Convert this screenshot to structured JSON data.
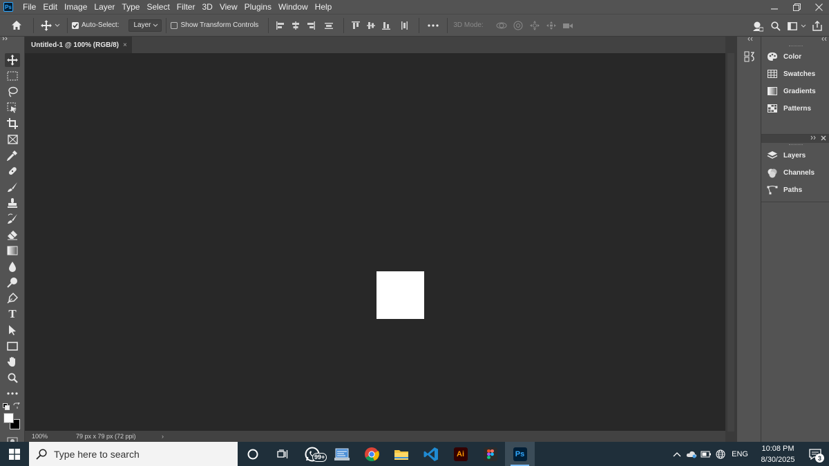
{
  "app": {
    "logo_text": "Ps",
    "menu": [
      "File",
      "Edit",
      "Image",
      "Layer",
      "Type",
      "Select",
      "Filter",
      "3D",
      "View",
      "Plugins",
      "Window",
      "Help"
    ]
  },
  "options_bar": {
    "auto_select_label": "Auto-Select:",
    "auto_select_checked": true,
    "target_select_value": "Layer",
    "show_transform_label": "Show Transform Controls",
    "show_transform_checked": false,
    "mode_3d_label": "3D Mode:"
  },
  "document": {
    "tab_title": "Untitled-1 @ 100% (RGB/8)",
    "close_glyph": "×",
    "zoom": "100%",
    "doc_info": "79 px x 79 px (72 ppi)",
    "status_arrow": "›"
  },
  "tools": [
    {
      "name": "move-tool-icon",
      "active": true
    },
    {
      "name": "rectangular-marquee-tool-icon"
    },
    {
      "name": "lasso-tool-icon"
    },
    {
      "name": "object-selection-tool-icon"
    },
    {
      "name": "crop-tool-icon"
    },
    {
      "name": "frame-tool-icon"
    },
    {
      "name": "eyedropper-tool-icon"
    },
    {
      "name": "healing-brush-tool-icon"
    },
    {
      "name": "brush-tool-icon"
    },
    {
      "name": "clone-stamp-tool-icon"
    },
    {
      "name": "history-brush-tool-icon"
    },
    {
      "name": "eraser-tool-icon"
    },
    {
      "name": "gradient-tool-icon"
    },
    {
      "name": "blur-tool-icon"
    },
    {
      "name": "dodge-tool-icon"
    },
    {
      "name": "pen-tool-icon"
    },
    {
      "name": "type-tool-icon"
    },
    {
      "name": "path-selection-tool-icon"
    },
    {
      "name": "rectangle-tool-icon"
    },
    {
      "name": "hand-tool-icon"
    },
    {
      "name": "zoom-tool-icon"
    },
    {
      "name": "edit-toolbar-icon"
    }
  ],
  "type_tool_glyph": "T",
  "panels": {
    "group1": [
      "Color",
      "Swatches",
      "Gradients",
      "Patterns"
    ],
    "group2": [
      "Layers",
      "Channels",
      "Paths"
    ]
  },
  "colors": {
    "foreground": "#ffffff",
    "background": "#000000",
    "accent": "#31a8ff"
  },
  "taskbar": {
    "search_placeholder": "Type here to search",
    "whatsapp_badge": "99+",
    "illustrator_label": "Ai",
    "photoshop_label": "Ps",
    "language": "ENG",
    "time": "10:08 PM",
    "date": "8/30/2025",
    "notification_count": "3"
  }
}
